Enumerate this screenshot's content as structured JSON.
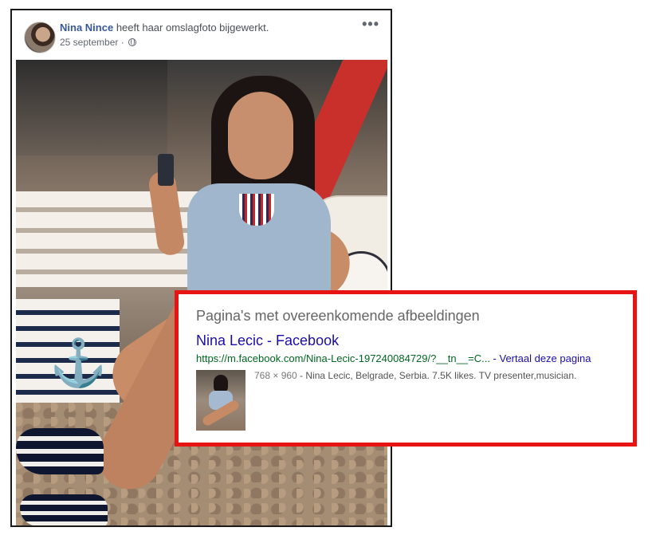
{
  "post": {
    "author": "Nina Nince",
    "action": "heeft haar omslagfoto bijgewerkt.",
    "date": "25 september",
    "date_separator": "·",
    "more_glyph": "•••",
    "icons": {
      "privacy": "globe-icon",
      "more": "more-options-icon"
    }
  },
  "search_result": {
    "section_title": "Pagina's met overeenkomende afbeeldingen",
    "title": "Nina Lecic - Facebook",
    "url": "https://m.facebook.com/Nina-Lecic-197240084729/?__tn__=C...",
    "url_separator": " - ",
    "translate_label": "Vertaal deze pagina",
    "dimensions": "768 × 960",
    "snippet": " - Nina Lecic, Belgrade, Serbia. 7.5K likes. TV presenter,musician."
  },
  "colors": {
    "highlight_border": "#e81414",
    "fb_link": "#385898",
    "result_title": "#1a0dab",
    "result_url": "#006621"
  }
}
